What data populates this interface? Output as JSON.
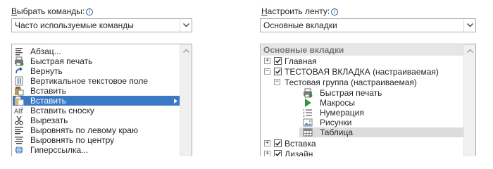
{
  "left": {
    "label_underline": "В",
    "label_rest": "ыбрать команды:",
    "combo_value": "Часто используемые команды",
    "items": [
      {
        "label": "Абзац...",
        "icon": "paragraph-icon",
        "selected": false,
        "submenu": false
      },
      {
        "label": "Быстрая печать",
        "icon": "quick-print-icon",
        "selected": false,
        "submenu": false
      },
      {
        "label": "Вернуть",
        "icon": "redo-icon",
        "selected": false,
        "submenu": false
      },
      {
        "label": "Вертикальное текстовое поле",
        "icon": "vertical-textbox-icon",
        "selected": false,
        "submenu": false
      },
      {
        "label": "Вставить",
        "icon": "paste-icon",
        "selected": false,
        "submenu": false
      },
      {
        "label": "Вставить",
        "icon": "paste-options-icon",
        "selected": true,
        "submenu": true
      },
      {
        "label": "Вставить сноску",
        "icon": "footnote-icon",
        "selected": false,
        "submenu": false
      },
      {
        "label": "Вырезать",
        "icon": "scissors-icon",
        "selected": false,
        "submenu": false
      },
      {
        "label": "Выровнять по левому краю",
        "icon": "align-left-icon",
        "selected": false,
        "submenu": false
      },
      {
        "label": "Выровнять по центру",
        "icon": "align-center-icon",
        "selected": false,
        "submenu": false
      },
      {
        "label": "Гиперссылка...",
        "icon": "hyperlink-icon",
        "selected": false,
        "submenu": false
      }
    ]
  },
  "right": {
    "label_underline": "Н",
    "label_rest": "астроить ленту:",
    "combo_value": "Основные вкладки",
    "header": "Основные вкладки",
    "tree": {
      "tab_home": "Главная",
      "tab_custom": "ТЕСТОВАЯ ВКЛАДКА (настраиваемая)",
      "group_custom": "Тестовая группа (настраиваемая)",
      "commands": [
        {
          "label": "Быстрая печать",
          "icon": "quick-print-icon",
          "submenu": false,
          "highlighted": false
        },
        {
          "label": "Макросы",
          "icon": "play-macro-icon",
          "submenu": false,
          "highlighted": false
        },
        {
          "label": "Нумерация",
          "icon": "numbering-icon",
          "submenu": true,
          "highlighted": false
        },
        {
          "label": "Рисунки",
          "icon": "picture-icon",
          "submenu": false,
          "highlighted": false
        },
        {
          "label": "Таблица",
          "icon": "table-icon",
          "submenu": true,
          "highlighted": true
        }
      ],
      "tab_insert": "Вставка",
      "tab_design": "Дизайн"
    }
  },
  "colors": {
    "selection": "#3b79c4",
    "header_bg": "#e6e6e6",
    "highlight": "#dcdcdc"
  }
}
